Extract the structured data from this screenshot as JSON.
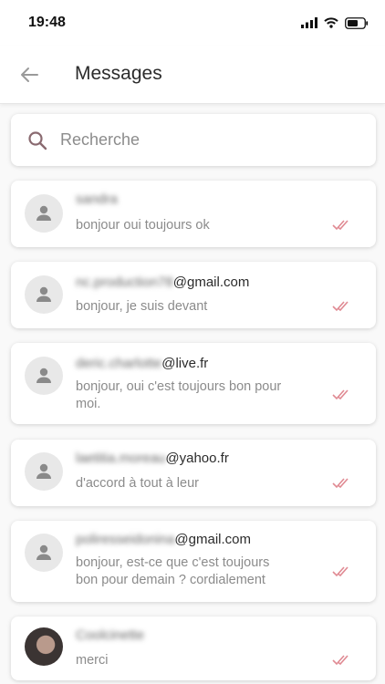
{
  "status_bar": {
    "time": "19:48"
  },
  "header": {
    "title": "Messages",
    "back_icon": "arrow-left-icon"
  },
  "search": {
    "placeholder": "Recherche",
    "value": ""
  },
  "colors": {
    "accent": "#e08a93",
    "avatar_bg": "#e8e8e8",
    "muted_text": "#8b8b8b"
  },
  "conversations": [
    {
      "name_obscured": "sandra",
      "name_suffix": "",
      "preview": "bonjour oui toujours ok",
      "status_icon": "double-check-icon"
    },
    {
      "name_obscured": "nc.production78",
      "name_suffix": "@gmail.com",
      "preview": "bonjour, je suis devant",
      "status_icon": "double-check-icon"
    },
    {
      "name_obscured": "deric.charlotte",
      "name_suffix": "@live.fr",
      "preview_line1": "bonjour, oui c'est toujours bon pour",
      "preview_line2": "moi.",
      "status_icon": "double-check-icon"
    },
    {
      "name_obscured": "laetitia.moreau",
      "name_suffix": "@yahoo.fr",
      "preview": "d'accord à tout à leur",
      "status_icon": "double-check-icon"
    },
    {
      "name_obscured": "poliresseidonina",
      "name_suffix": "@gmail.com",
      "preview_line1": "bonjour, est-ce que c'est toujours",
      "preview_line2": "bon pour demain ? cordialement",
      "status_icon": "double-check-icon"
    },
    {
      "name_obscured": "Coolcinette",
      "name_suffix": "",
      "preview": "merci",
      "status_icon": "double-check-icon"
    }
  ]
}
